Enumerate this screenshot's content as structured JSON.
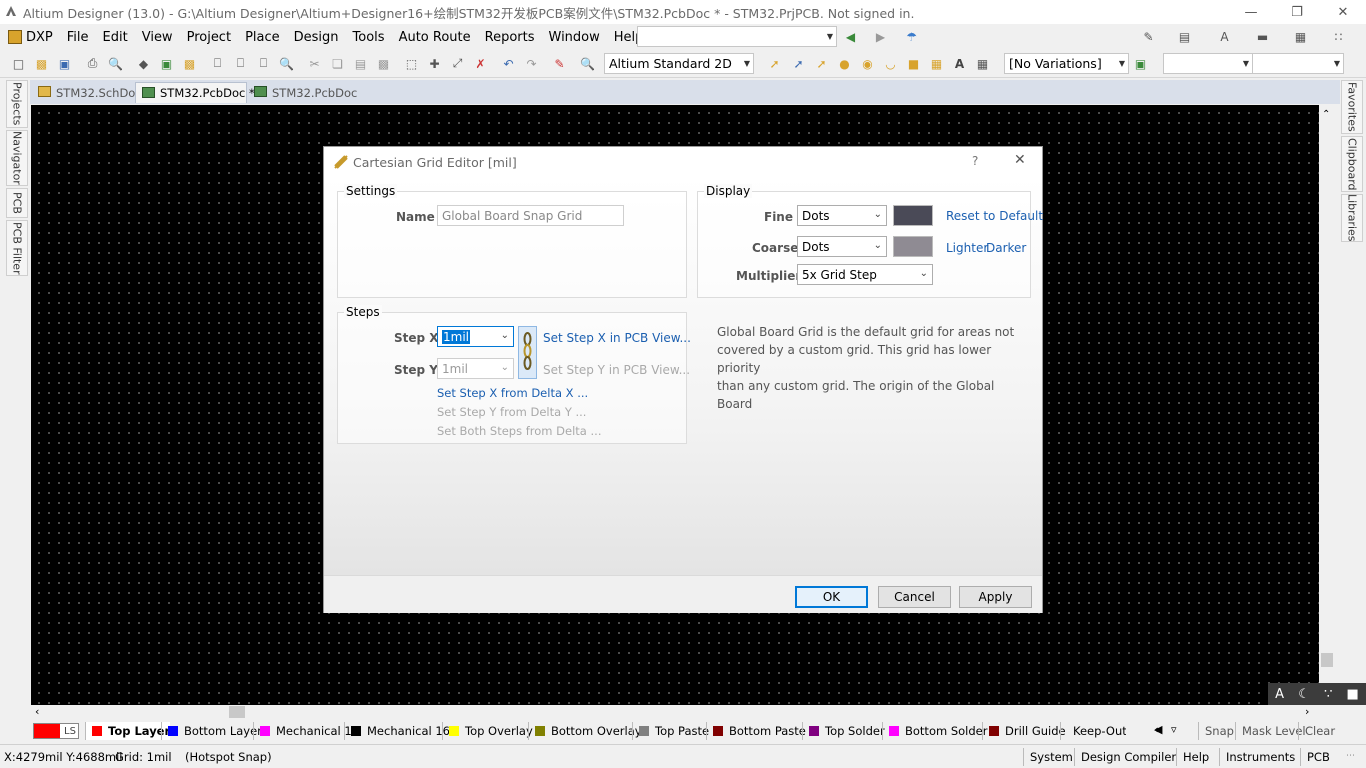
{
  "titlebar": {
    "title": "Altium Designer (13.0) - G:\\Altium Designer\\Altium+Designer16+绘制STM32开发板PCB案例文件\\STM32.PcbDoc * - STM32.PrjPCB. Not signed in."
  },
  "menu": [
    "DXP",
    "File",
    "Edit",
    "View",
    "Project",
    "Place",
    "Design",
    "Tools",
    "Auto Route",
    "Reports",
    "Window",
    "Help"
  ],
  "toolbar": {
    "view_mode": "Altium Standard 2D",
    "variations": "[No Variations]"
  },
  "left_panels": [
    "Projects",
    "Navigator",
    "PCB",
    "PCB Filter"
  ],
  "right_panels": [
    "Favorites",
    "Clipboard",
    "Libraries"
  ],
  "doc_tabs": [
    {
      "label": "STM32.SchDoc"
    },
    {
      "label": "STM32.PcbDoc *"
    },
    {
      "label": "STM32.PcbDoc"
    }
  ],
  "dialog": {
    "title": "Cartesian Grid Editor [mil]",
    "help": "?",
    "settings": {
      "title": "Settings",
      "name_label": "Name",
      "name_value": "Global Board Snap Grid"
    },
    "steps": {
      "title": "Steps",
      "step_x_label": "Step X",
      "step_x_value": "1mil",
      "step_y_label": "Step Y",
      "step_y_value": "1mil",
      "set_x_pcb": "Set Step X in PCB View...",
      "set_y_pcb": "Set Step Y in PCB View...",
      "set_x_delta": "Set Step X from Delta X ...",
      "set_y_delta": "Set Step Y from Delta Y ...",
      "set_both": "Set Both Steps from Delta ..."
    },
    "display": {
      "title": "Display",
      "fine_label": "Fine",
      "fine_value": "Dots",
      "fine_color": "#4a4a57",
      "coarse_label": "Coarse",
      "coarse_value": "Dots",
      "coarse_color": "#8f8b93",
      "multiplier_label": "Multiplier",
      "multiplier_value": "5x Grid Step",
      "reset": "Reset to Default",
      "lighter": "Lighter",
      "darker": "Darker"
    },
    "description": [
      "Global Board Grid is the default grid for areas not",
      "covered by a custom grid. This grid has lower priority",
      "than any custom grid. The origin of the Global Board"
    ],
    "buttons": {
      "ok": "OK",
      "cancel": "Cancel",
      "apply": "Apply"
    }
  },
  "layers": {
    "ls": "LS",
    "items": [
      {
        "name": "Top Layer",
        "color": "#ff0000"
      },
      {
        "name": "Bottom Layer",
        "color": "#0000ff"
      },
      {
        "name": "Mechanical 1",
        "color": "#ff00ff"
      },
      {
        "name": "Mechanical 16",
        "color": "#000000"
      },
      {
        "name": "Top Overlay",
        "color": "#ffff00"
      },
      {
        "name": "Bottom Overlay",
        "color": "#808000"
      },
      {
        "name": "Top Paste",
        "color": "#808080"
      },
      {
        "name": "Bottom Paste",
        "color": "#800000"
      },
      {
        "name": "Top Solder",
        "color": "#800080"
      },
      {
        "name": "Bottom Solder",
        "color": "#ff00ff"
      },
      {
        "name": "Drill Guide",
        "color": "#800000"
      },
      {
        "name": "Keep-Out L",
        "color": "#ff00ff"
      }
    ],
    "snap": "Snap",
    "mask_level": "Mask Level",
    "clear": "Clear"
  },
  "status": {
    "coords": "X:4279mil Y:4688mil",
    "grid": "Grid: 1mil",
    "snap": "(Hotspot Snap)",
    "right": [
      "System",
      "Design Compiler",
      "Help",
      "Instruments",
      "PCB"
    ]
  },
  "colors": {
    "canvas": "#000000",
    "link": "#1b5fb0",
    "accent": "#0078d7"
  }
}
